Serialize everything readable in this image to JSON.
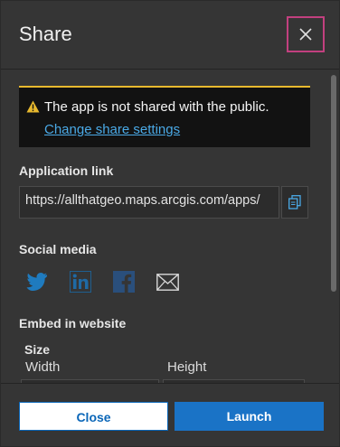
{
  "dialog": {
    "title": "Share",
    "close_icon": "close-icon"
  },
  "notice": {
    "icon": "warning-icon",
    "text": "The app is not shared with the public.",
    "link": "Change share settings",
    "accent_color": "#e8b92e"
  },
  "app_link": {
    "label": "Application link",
    "value": "https://allthatgeo.maps.arcgis.com/apps/",
    "copy_icon": "copy-icon"
  },
  "social": {
    "label": "Social media",
    "items": [
      "twitter-icon",
      "linkedin-icon",
      "facebook-icon",
      "email-icon"
    ]
  },
  "embed": {
    "label": "Embed in website",
    "size_label": "Size",
    "width_label": "Width",
    "height_label": "Height"
  },
  "footer": {
    "close_label": "Close",
    "launch_label": "Launch",
    "accent_color": "#1a73c6"
  }
}
